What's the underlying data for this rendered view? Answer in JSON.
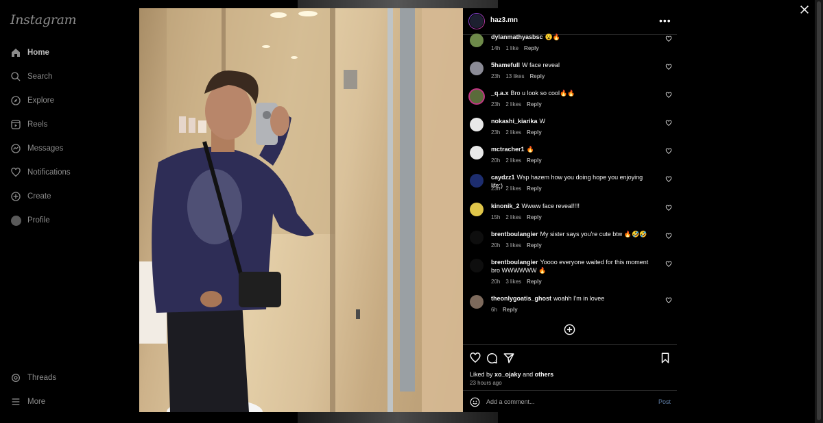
{
  "app": {
    "logo_text": "Instagram"
  },
  "sidebar": {
    "items": [
      {
        "label": "Home",
        "icon": "home-icon"
      },
      {
        "label": "Search",
        "icon": "search-icon"
      },
      {
        "label": "Explore",
        "icon": "compass-icon"
      },
      {
        "label": "Reels",
        "icon": "reels-icon"
      },
      {
        "label": "Messages",
        "icon": "messenger-icon"
      },
      {
        "label": "Notifications",
        "icon": "heart-icon"
      },
      {
        "label": "Create",
        "icon": "plus-square-icon"
      },
      {
        "label": "Profile",
        "icon": "avatar"
      }
    ],
    "bottom": [
      {
        "label": "Threads",
        "icon": "threads-icon"
      },
      {
        "label": "More",
        "icon": "hamburger-icon"
      }
    ]
  },
  "post": {
    "username": "haz3.mn",
    "comments": [
      {
        "user": "dylanmathyasbsc",
        "text": "😮🔥",
        "time": "14h",
        "likes": "1 like",
        "reply": "Reply"
      },
      {
        "user": "5hamefull",
        "text": "W face reveal",
        "time": "23h",
        "likes": "13 likes",
        "reply": "Reply"
      },
      {
        "user": "_q.a.x",
        "text": "Bro u look so cool🔥🔥",
        "time": "23h",
        "likes": "2 likes",
        "reply": "Reply"
      },
      {
        "user": "nokashi_kiarika",
        "text": "W",
        "time": "23h",
        "likes": "2 likes",
        "reply": "Reply"
      },
      {
        "user": "mctracher1",
        "text": "🔥",
        "time": "20h",
        "likes": "2 likes",
        "reply": "Reply"
      },
      {
        "user": "caydzz1",
        "text": "Wsp hazem how you doing hope you enjoying life:)",
        "time": "23h",
        "likes": "2 likes",
        "reply": "Reply"
      },
      {
        "user": "kinonik_2",
        "text": "Wwww face reveal!!!!",
        "time": "15h",
        "likes": "2 likes",
        "reply": "Reply"
      },
      {
        "user": "brentboulangier",
        "text": "My sister says you're cute btw 🔥🤣🤣",
        "time": "20h",
        "likes": "3 likes",
        "reply": "Reply"
      },
      {
        "user": "brentboulangier",
        "text": "Yoooo everyone waited for this moment bro WWWWWW 🔥",
        "time": "20h",
        "likes": "3 likes",
        "reply": "Reply"
      },
      {
        "user": "theonlygoatis_ghost",
        "text": "woahh I'm in lovee",
        "time": "6h",
        "likes": "",
        "reply": "Reply"
      }
    ],
    "liked_by_prefix": "Liked by",
    "liked_by_user": "xo_ojaky",
    "liked_by_and": "and",
    "liked_by_others": "others",
    "posted_time": "23 hours ago",
    "comment_placeholder": "Add a comment...",
    "post_button": "Post"
  },
  "colors": {
    "background": "#000000",
    "divider": "#262626",
    "muted": "#a8a8a8",
    "link": "#5f7fa8"
  }
}
